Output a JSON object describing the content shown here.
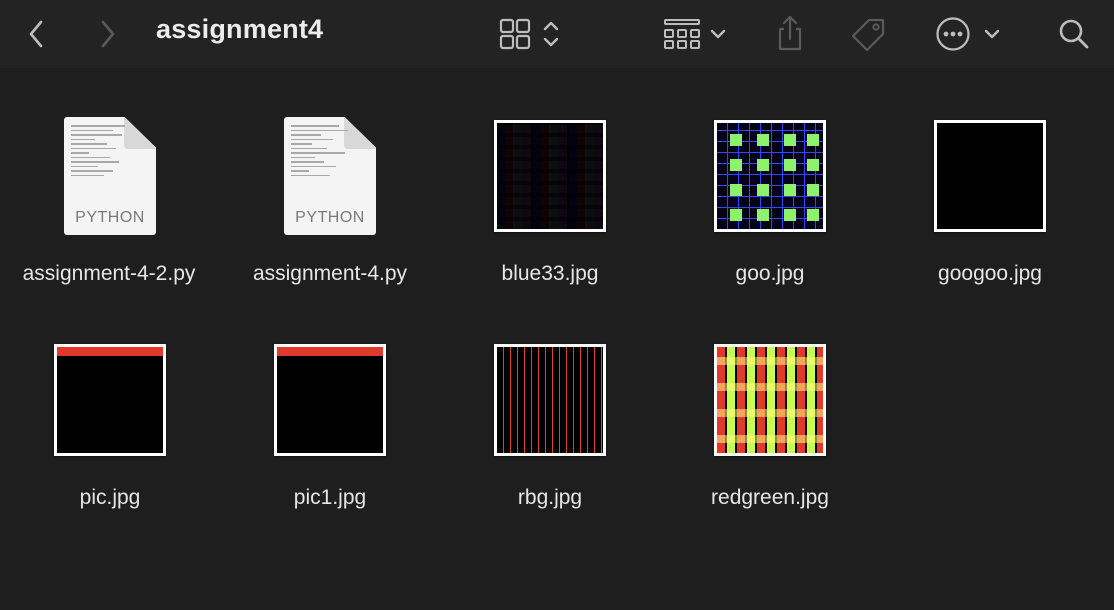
{
  "window": {
    "title": "assignment4"
  },
  "toolbar": {
    "back_icon": "chevron-left-icon",
    "forward_icon": "chevron-right-icon",
    "view_icon": "grid-view-icon",
    "group_icon": "group-by-icon",
    "share_icon": "share-icon",
    "tag_icon": "tag-icon",
    "more_icon": "ellipsis-circle-icon",
    "search_icon": "search-icon"
  },
  "files": [
    {
      "name": "assignment-4-2.py",
      "kind": "python",
      "icon_label": "PYTHON"
    },
    {
      "name": "assignment-4.py",
      "kind": "python",
      "icon_label": "PYTHON"
    },
    {
      "name": "blue33.jpg",
      "kind": "image"
    },
    {
      "name": "goo.jpg",
      "kind": "image"
    },
    {
      "name": "googoo.jpg",
      "kind": "image"
    },
    {
      "name": "pic.jpg",
      "kind": "image"
    },
    {
      "name": "pic1.jpg",
      "kind": "image"
    },
    {
      "name": "rbg.jpg",
      "kind": "image"
    },
    {
      "name": "redgreen.jpg",
      "kind": "image"
    }
  ],
  "colors": {
    "background": "#1e1e1e",
    "toolbar": "#232323",
    "text": "#e6e6e6",
    "icon": "#bdbdbd",
    "icon_disabled": "#5a5a5a"
  }
}
